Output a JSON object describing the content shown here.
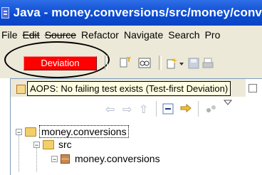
{
  "window": {
    "title": "Java - money.conversions/src/money/conv"
  },
  "menubar": {
    "items": [
      "File",
      "Edit",
      "Source",
      "Refactor",
      "Navigate",
      "Search",
      "Pro"
    ]
  },
  "toolbar": {
    "deviation_label": "Deviation"
  },
  "tooltip": {
    "text": "AOPS: No failing test exists (Test-first Deviation)"
  },
  "tree": {
    "project": "money.conversions",
    "src_folder": "src",
    "package": "money.conversions"
  },
  "colors": {
    "deviation_bg": "#ff0000",
    "titlebar": "#0a4ad0",
    "tooltip_bg": "#ffffe1"
  }
}
